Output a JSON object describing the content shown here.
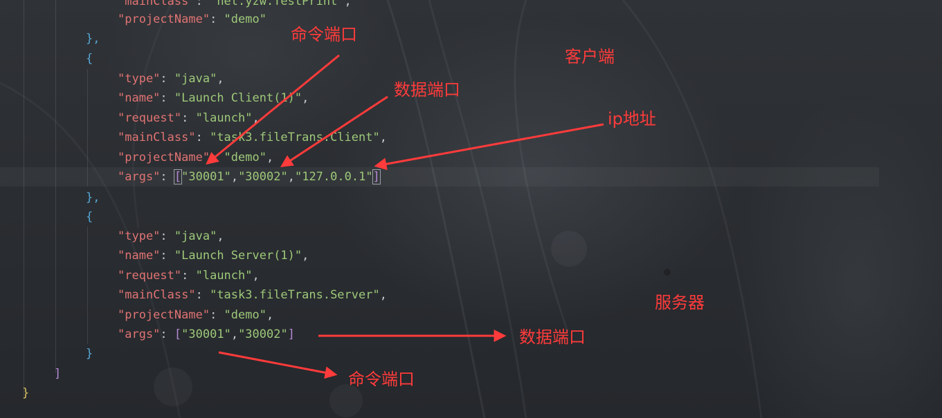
{
  "colors": {
    "background": "#2b2d31",
    "json_key": "#e07373",
    "json_string": "#9ec97a",
    "punctuation": "#c8ccd2",
    "brace": "#56a8d6",
    "bracket": "#b78ad8",
    "outer_brace": "#d9c15f",
    "annotation": "#ff3b3b"
  },
  "code": {
    "line_1_key": "\"mainClass\"",
    "line_1_value": "\"net.yzw.TestPrint\"",
    "line_2_key": "\"projectName\"",
    "line_2_value": "\"demo\"",
    "line_3_close": "},",
    "line_4_open": "{",
    "client": {
      "type_key": "\"type\"",
      "type_value": "\"java\"",
      "name_key": "\"name\"",
      "name_value": "\"Launch Client(1)\"",
      "request_key": "\"request\"",
      "request_value": "\"launch\"",
      "mainclass_key": "\"mainClass\"",
      "mainclass_value": "\"task3.fileTrans.Client\"",
      "projectname_key": "\"projectName\"",
      "projectname_value": "\"demo\"",
      "args_key": "\"args\"",
      "arg_1": "\"30001\"",
      "arg_2": "\"30002\"",
      "arg_3": "\"127.0.0.1\"",
      "close": "},"
    },
    "server_open": "{",
    "server": {
      "type_key": "\"type\"",
      "type_value": "\"java\"",
      "name_key": "\"name\"",
      "name_value": "\"Launch Server(1)\"",
      "request_key": "\"request\"",
      "request_value": "\"launch\"",
      "mainclass_key": "\"mainClass\"",
      "mainclass_value": "\"task3.fileTrans.Server\"",
      "projectname_key": "\"projectName\"",
      "projectname_value": "\"demo\"",
      "args_key": "\"args\"",
      "arg_1": "\"30001\"",
      "arg_2": "\"30002\"",
      "close": "}"
    },
    "array_close": "]",
    "outer_close": "}"
  },
  "annotations": {
    "client_command_port": "命令端口",
    "client_data_port": "数据端口",
    "client_label": "客户端",
    "client_ip": "ip地址",
    "server_label": "服务器",
    "server_data_port": "数据端口",
    "server_command_port": "命令端口"
  }
}
